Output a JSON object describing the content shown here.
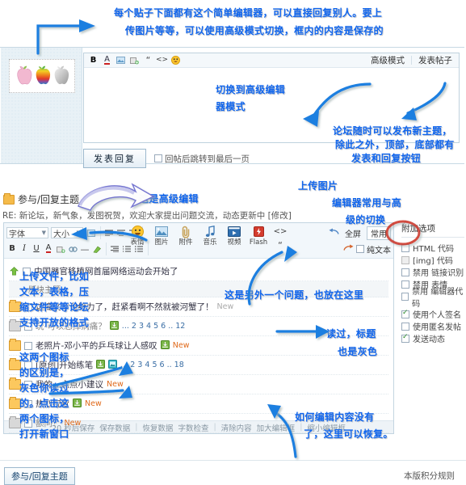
{
  "annotations": {
    "top1": "每个贴子下面都有这个简单编辑器，可以直接回复别人。要上",
    "top2": "传图片等等，可以使用高级模式切换，框内的内容是保存的",
    "switch_adv1": "切换到高级编辑",
    "switch_adv2": "器模式",
    "post_any1": "论坛随时可以发布新主题，",
    "post_any2": "除此之外，顶部，底部都有",
    "post_any3": "发表和回复按钮",
    "this_is_adv": "这是高级编辑",
    "upload_img": "上传图片",
    "toggle1": "编辑器常用与高",
    "toggle2": "级的切换",
    "upload_file1": "上传文件，比如",
    "upload_file2": "文本，表格，压",
    "upload_file3": "缩文件等等论坛",
    "upload_file4": "支持开放的格式",
    "icons1": "这两个图标",
    "icons2": "的区别是，",
    "icons3": "灰色你读过",
    "icons4": "的。点击这",
    "icons5": "两个图标，",
    "icons6": "打开新窗口",
    "another1": "这是另外一个问题，也放在这里",
    "read1": "读过，标题",
    "read2": "也是灰色",
    "restore1": "如何编辑内容没有",
    "restore2": "了，这里可以恢复。"
  },
  "simple_editor": {
    "toolbar_icons": [
      "bold-icon",
      "font-color-icon",
      "image-icon",
      "attachment-icon",
      "quote-icon",
      "code-icon",
      "smiley-icon"
    ],
    "advanced_mode": "高级模式",
    "post_thread": "发表帖子",
    "submit_reply": "发表回复",
    "jump_checkbox_label": "回帖后跳转到最后一页",
    "jump_checked": false,
    "body_text": ""
  },
  "advanced": {
    "header_title": "参与/回复主题",
    "subject_line": "RE: 新论坛，新气象，发图祝贺，欢迎大家提出问题交流，动态更新中 [修改]",
    "font_select": "字体",
    "size_select": "大小",
    "big_buttons": [
      {
        "label": "表情",
        "icon": "smiley-icon"
      },
      {
        "label": "图片",
        "icon": "image-icon"
      },
      {
        "label": "附件",
        "icon": "paperclip-icon"
      },
      {
        "label": "音乐",
        "icon": "music-note-icon"
      },
      {
        "label": "视频",
        "icon": "video-icon"
      },
      {
        "label": "Flash",
        "icon": "flash-icon"
      }
    ],
    "fullscreen": "全屏",
    "common": "常用",
    "plaintext": "纯文本",
    "plaintext_checked": false
  },
  "thread_list": {
    "sticky": {
      "title": "中国器官移植网首届网络运动会开始了",
      "icon": "up-arrow-icon"
    },
    "section_divider": "版块主题",
    "rows": [
      {
        "title": "这篇文章台给力了，赶紧看啊不然就被河蟹了！",
        "read": false,
        "new": "New",
        "new_gray": true,
        "pages": "",
        "badges": []
      },
      {
        "title": "玩-可以忘掉病痛？",
        "read": true,
        "new": "",
        "new_gray": false,
        "pages": "... 2 3 4 5 6 .. 12",
        "badges": [
          "attach-icon"
        ]
      },
      {
        "title": "老照片-邓小平的乒乓球让人感叹",
        "read": false,
        "new": "New",
        "new_gray": false,
        "pages": "",
        "badges": [
          "attach-icon"
        ]
      },
      {
        "title": "[原创]开始练笔",
        "read": false,
        "new": "",
        "new_gray": false,
        "pages": "... 2 3 4 5 6 .. 18",
        "badges": [
          "attach-icon",
          "image-icon"
        ]
      },
      {
        "title": "我的一点点小建议",
        "read": false,
        "new": "New",
        "new_gray": false,
        "pages": "",
        "badges": []
      },
      {
        "title": "热烈祝贺",
        "read": false,
        "new": "New",
        "new_gray": false,
        "pages": "",
        "badges": [
          "attach-icon"
        ]
      },
      {
        "title": "额问！",
        "read": true,
        "new": "New",
        "new_gray": false,
        "pages": "",
        "badges": []
      }
    ]
  },
  "editor_footer": {
    "autosave": "20 秒后保存",
    "save_data": "保存数据",
    "restore_data": "恢复数据",
    "word_count": "字数检查",
    "clear_content": "清除内容",
    "enlarge": "加大编辑框",
    "shrink": "缩小编辑框"
  },
  "options": {
    "title": "附加选项",
    "items": [
      {
        "label": "HTML 代码",
        "checked": false,
        "disabled": false
      },
      {
        "label": "[img] 代码",
        "checked": true,
        "disabled": true
      },
      {
        "label": "禁用 链接识别",
        "checked": false,
        "disabled": false
      },
      {
        "label": "禁用 表情",
        "checked": false,
        "disabled": false
      },
      {
        "label": "禁用 编辑器代码",
        "checked": false,
        "disabled": false
      }
    ],
    "items2": [
      {
        "label": "使用个人签名",
        "checked": true,
        "disabled": false
      },
      {
        "label": "使用匿名发帖",
        "checked": false,
        "disabled": true
      },
      {
        "label": "发送动态",
        "checked": true,
        "disabled": false
      }
    ]
  },
  "footer": {
    "reply_button": "参与/回复主题",
    "rules_link": "本版积分规则"
  },
  "colors": {
    "annotation": "#1166ee",
    "new_tag": "#e06a1b",
    "folder": "#fcc85e",
    "panel_bg": "#e8f1f6"
  }
}
